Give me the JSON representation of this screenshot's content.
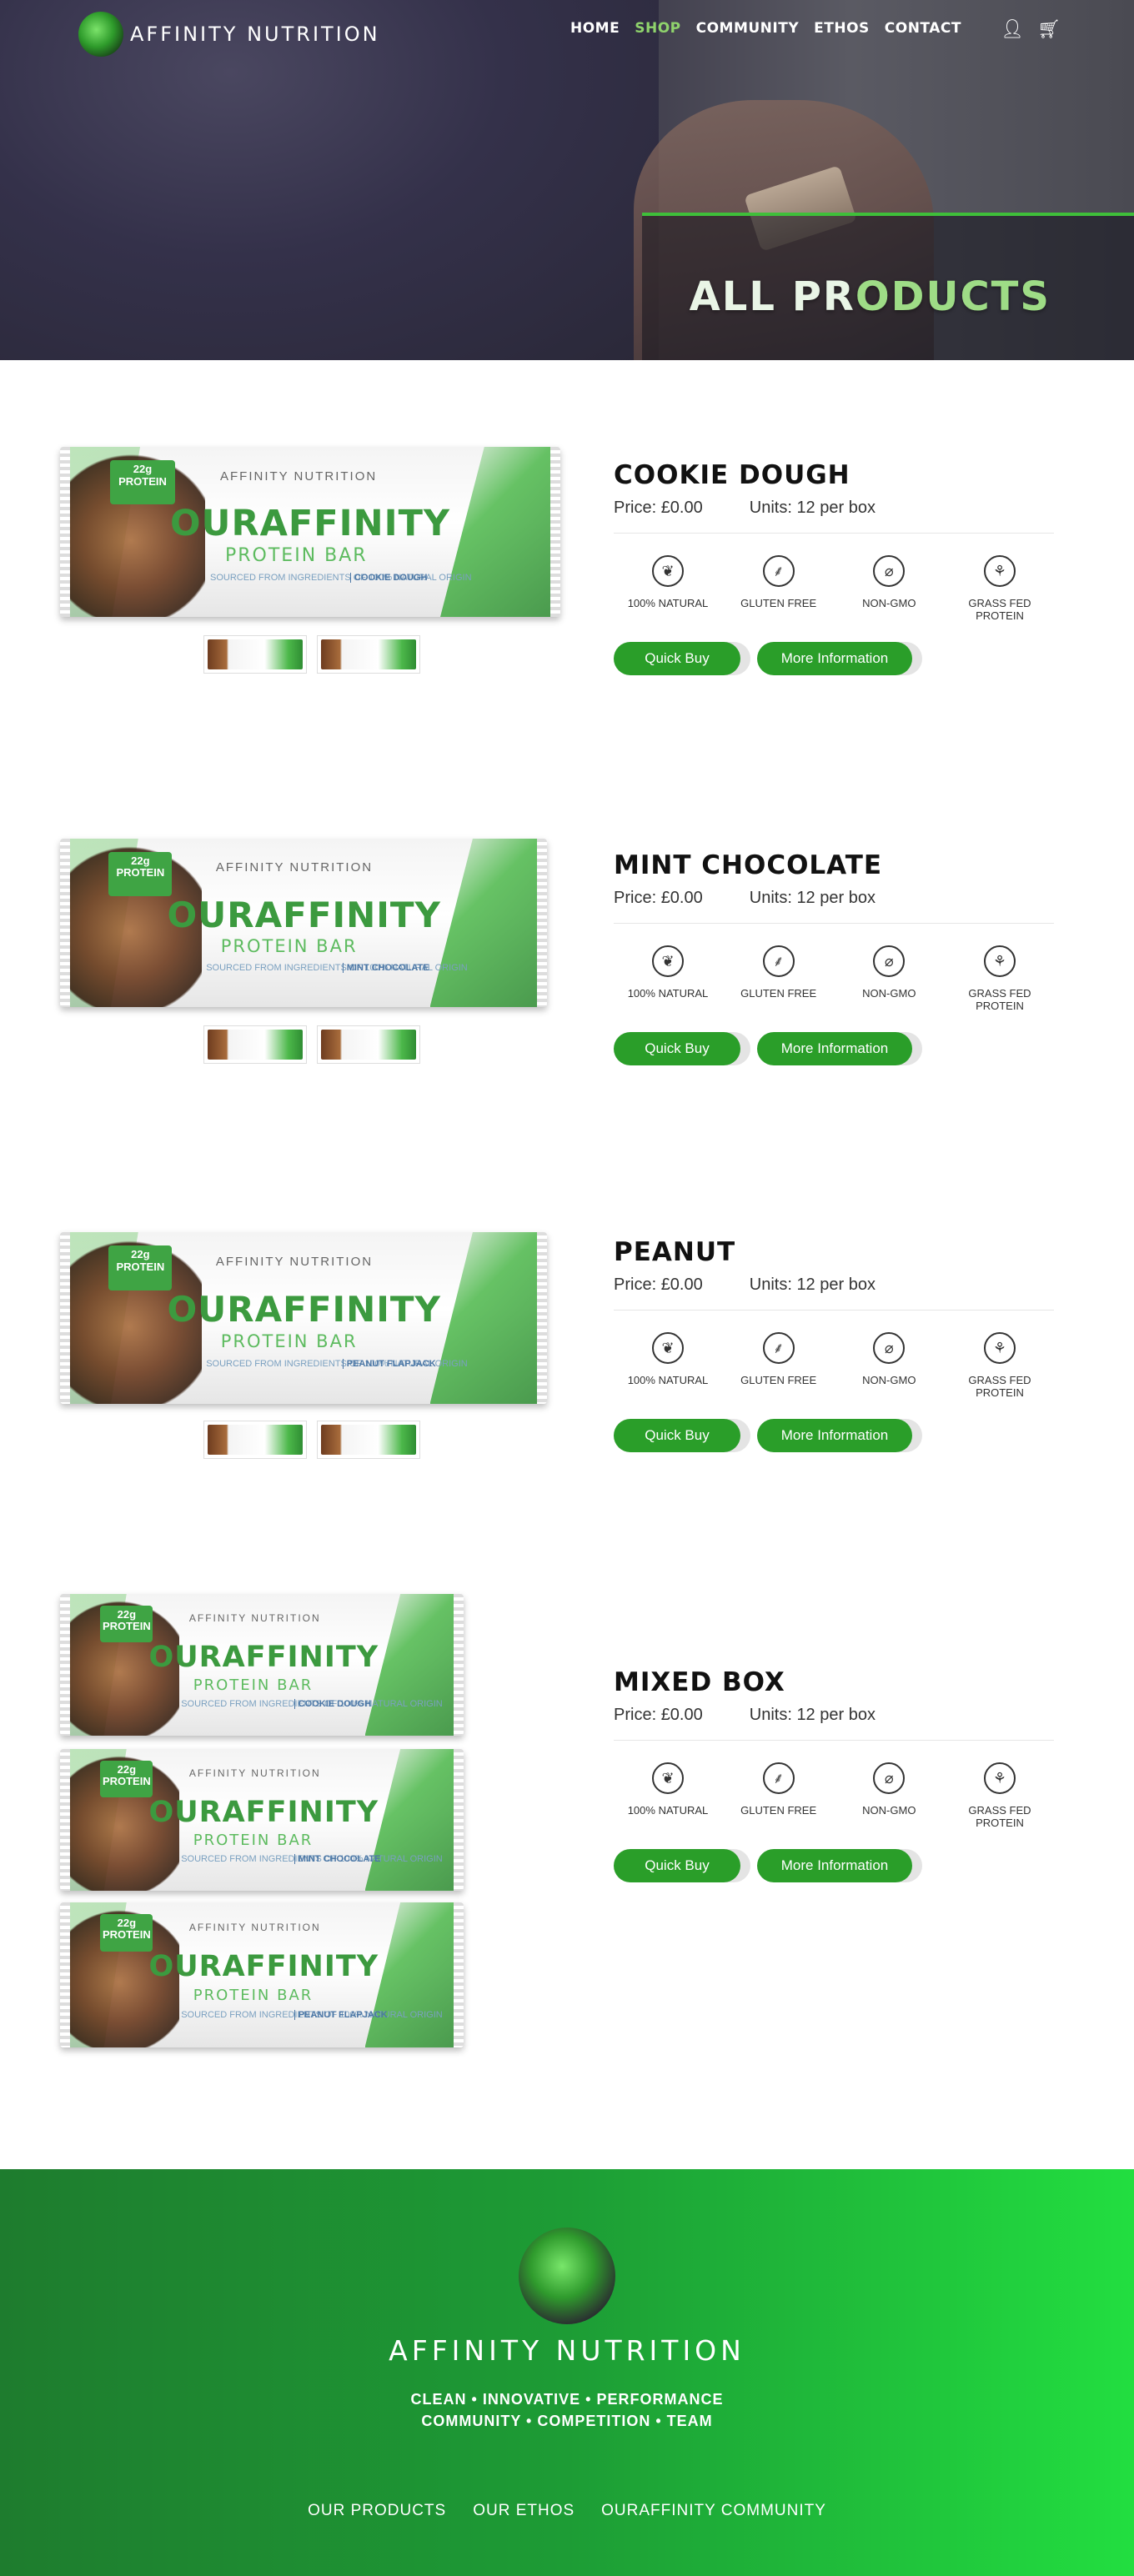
{
  "brand": {
    "name": "AFFINITY NUTRITION"
  },
  "nav": {
    "items": [
      {
        "label": "HOME",
        "active": false
      },
      {
        "label": "SHOP",
        "active": true
      },
      {
        "label": "COMMUNITY",
        "active": false
      },
      {
        "label": "ETHOS",
        "active": false
      },
      {
        "label": "CONTACT",
        "active": false
      }
    ],
    "icons": [
      "user-icon",
      "basket-icon"
    ]
  },
  "hero": {
    "title_main": "ALL PR",
    "title_accent": "ODUCTS"
  },
  "pack_text": {
    "badge": "22g PROTEIN",
    "brand_small": "AFFINITY NUTRITION",
    "brand": "OURAFFINITY",
    "sub": "PROTEIN BAR",
    "origin": "SOURCED FROM INGREDIENTS OF 100% NATURAL ORIGIN"
  },
  "products": [
    {
      "title": "COOKIE DOUGH",
      "price_label": "Price:",
      "price": "£0.00",
      "units_label": "Units:",
      "units": "12 per box",
      "flavour": "COOKIE DOUGH",
      "quick_buy": "Quick Buy",
      "more_info": "More Information"
    },
    {
      "title": "MINT CHOCOLATE",
      "price_label": "Price:",
      "price": "£0.00",
      "units_label": "Units:",
      "units": "12 per box",
      "flavour": "MINT CHOCOLATE",
      "quick_buy": "Quick Buy",
      "more_info": "More Information"
    },
    {
      "title": "PEANUT",
      "price_label": "Price:",
      "price": "£0.00",
      "units_label": "Units:",
      "units": "12 per box",
      "flavour": "PEANUT FLAPJACK",
      "quick_buy": "Quick Buy",
      "more_info": "More Information"
    },
    {
      "title": "MIXED BOX",
      "price_label": "Price:",
      "price": "£0.00",
      "units_label": "Units:",
      "units": "12 per box",
      "quick_buy": "Quick Buy",
      "more_info": "More Information"
    }
  ],
  "features": [
    {
      "label": "100% NATURAL",
      "icon": "leaf-icon"
    },
    {
      "label": "GLUTEN FREE",
      "icon": "wheat-icon"
    },
    {
      "label": "NON-GMO",
      "icon": "non-gmo-icon"
    },
    {
      "label": "GRASS FED PROTEIN",
      "icon": "grass-icon"
    }
  ],
  "footer": {
    "name": "AFFINITY NUTRITION",
    "tagline_1": "CLEAN • INNOVATIVE • PERFORMANCE",
    "tagline_2": "COMMUNITY • COMPETITION • TEAM",
    "links": [
      "OUR PRODUCTS",
      "OUR ETHOS",
      "OURAFFINITY COMMUNITY"
    ]
  },
  "colors": {
    "accent": "#2a9e29",
    "nav_active": "#8fd36c",
    "footer_start": "#1e7c2e",
    "footer_end": "#22de40"
  }
}
